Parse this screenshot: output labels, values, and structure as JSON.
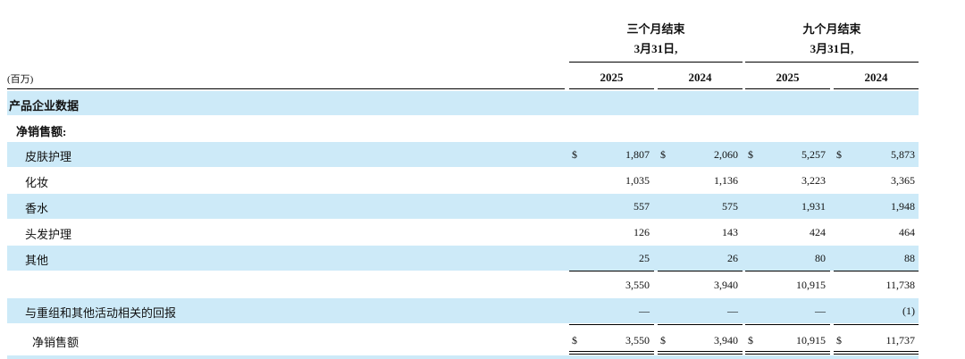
{
  "header": {
    "period_groups": [
      {
        "line1": "三个月结束",
        "line2": "3月31日,"
      },
      {
        "line1": "九个月结束",
        "line2": "3月31日,"
      }
    ],
    "years": [
      "2025",
      "2024",
      "2025",
      "2024"
    ],
    "unit": "(百万)"
  },
  "currency": "$",
  "sections": {
    "product_data": "产品企业数据",
    "net_sales_heading": "净销售额:"
  },
  "rows": [
    {
      "label": "皮肤护理",
      "values": [
        "1,807",
        "2,060",
        "5,257",
        "5,873"
      ]
    },
    {
      "label": "化妆",
      "values": [
        "1,035",
        "1,136",
        "3,223",
        "3,365"
      ]
    },
    {
      "label": "香水",
      "values": [
        "557",
        "575",
        "1,931",
        "1,948"
      ]
    },
    {
      "label": "头发护理",
      "values": [
        "126",
        "143",
        "424",
        "464"
      ]
    },
    {
      "label": "其他",
      "values": [
        "25",
        "26",
        "80",
        "88"
      ]
    }
  ],
  "subtotal": {
    "values": [
      "3,550",
      "3,940",
      "10,915",
      "11,738"
    ]
  },
  "returns": {
    "label": "与重组和其他活动相关的回报",
    "values": [
      "—",
      "—",
      "—",
      "(1)"
    ]
  },
  "total": {
    "label": "净销售额",
    "values": [
      "3,550",
      "3,940",
      "10,915",
      "11,737"
    ]
  }
}
